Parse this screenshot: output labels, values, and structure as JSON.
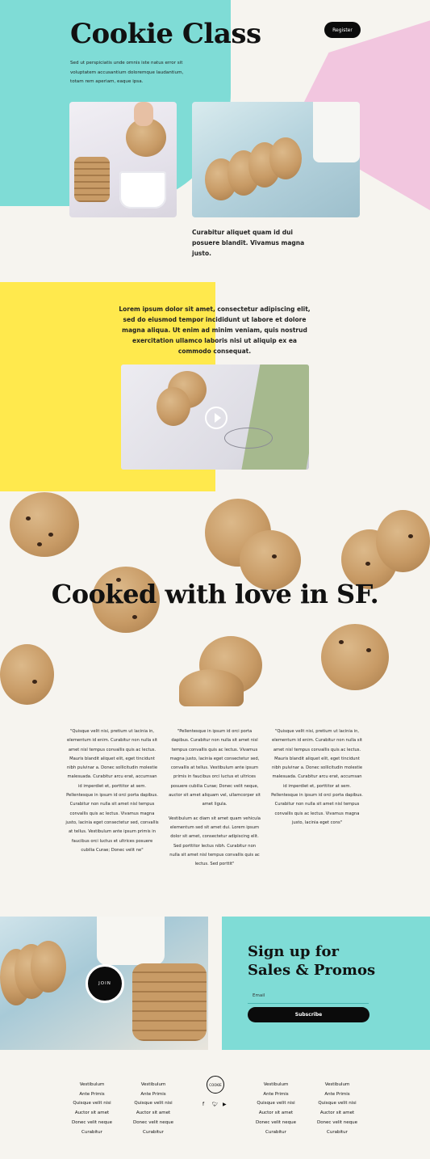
{
  "colors": {
    "teal": "#7fdcd6",
    "pink": "#f2c6df",
    "yellow": "#ffe94d",
    "cream": "#f6f4ef",
    "black": "#0b0b0b"
  },
  "header": {
    "title": "Cookie Class",
    "subtitle": "Sed ut perspiciatis unde omnis iste natus error sit voluptatem accusantium doloremque laudantium, totam rem aperiam, eaque ipsa.",
    "register_label": "Register"
  },
  "hero": {
    "caption": "Curabitur aliquet quam id dui posuere blandit. Vivamus magna justo."
  },
  "intro": {
    "text": "Lorem ipsum dolor sit amet, consectetur adipiscing elit, sed do eiusmod tempor incididunt ut labore et dolore magna aliqua. Ut enim ad minim veniam, quis nostrud exercitation ullamco laboris nisi ut aliquip ex ea commodo consequat.",
    "play_icon": "play-icon"
  },
  "banner": {
    "title": "Cooked with love in SF."
  },
  "testimonials": [
    {
      "paragraphs": [
        "\"Quisque velit nisi, pretium ut lacinia in, elementum id enim. Curabitur non nulla sit amet nisl tempus convallis quis ac lectus. Mauris blandit aliquet elit, eget tincidunt nibh pulvinar a. Donec sollicitudin molestie malesuada. Curabitur arcu erat, accumsan id imperdiet et, porttitor at sem. Pellentesque in ipsum id orci porta dapibus. Curabitur non nulla sit amet nisl tempus convallis quis ac lectus. Vivamus magna justo, lacinia eget consectetur sed, convallis at tellus. Vestibulum ante ipsum primis in faucibus orci luctus et ultrices posuere cubilia Curae; Donec velit ne\""
      ]
    },
    {
      "paragraphs": [
        "\"Pellentesque in ipsum id orci porta dapibus. Curabitur non nulla sit amet nisl tempus convallis quis ac lectus. Vivamus magna justo, lacinia eget consectetur sed, convallis at tellus. Vestibulum ante ipsum primis in faucibus orci luctus et ultrices posuere cubilia Curae; Donec velit neque, auctor sit amet aliquam vel, ullamcorper sit amet ligula.",
        "Vestibulum ac diam sit amet quam vehicula elementum sed sit amet dui. Lorem ipsum dolor sit amet, consectetur adipiscing elit. Sed porttitor lectus nibh. Curabitur non nulla sit amet nisl tempus convallis quis ac lectus. Sed porttit\""
      ]
    },
    {
      "paragraphs": [
        "\"Quisque velit nisi, pretium ut lacinia in, elementum id enim. Curabitur non nulla sit amet nisl tempus convallis quis ac lectus. Mauris blandit aliquet elit, eget tincidunt nibh pulvinar a. Donec sollicitudin molestie malesuada. Curabitur arcu erat, accumsan id imperdiet et, porttitor at sem. Pellentesque in ipsum id orci porta dapibus. Curabitur non nulla sit amet nisl tempus convallis quis ac lectus. Vivamus magna justo, lacinia eget cons\""
      ]
    }
  ],
  "signup": {
    "title": "Sign up for Sales & Promos",
    "email_placeholder": "Email",
    "subscribe_label": "Subscribe",
    "join_label": "JOIN"
  },
  "footer": {
    "columns": [
      [
        "Vestibulum",
        "Ante Primis",
        "Quisque velit nisi",
        "Auctor sit amet",
        "Donec velit neque",
        "Curabitur"
      ],
      [
        "Vestibulum",
        "Ante Primis",
        "Quisque velit nisi",
        "Auctor sit amet",
        "Donec velit neque",
        "Curabitur"
      ],
      [
        "Vestibulum",
        "Ante Primis",
        "Quisque velit nisi",
        "Auctor sit amet",
        "Donec velit neque",
        "Curabitur"
      ],
      [
        "Vestibulum",
        "Ante Primis",
        "Quisque velit nisi",
        "Auctor sit amet",
        "Donec velit neque",
        "Curabitur"
      ]
    ],
    "logo_text": "COOKIE",
    "social": [
      "facebook-icon",
      "twitter-icon",
      "youtube-icon"
    ]
  }
}
